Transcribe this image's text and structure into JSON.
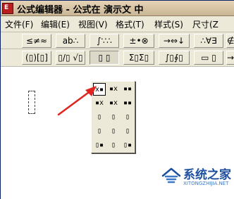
{
  "titlebar": {
    "title": "公式编辑器 - 公式在 演示文 中",
    "icon_letter": "Ε"
  },
  "menubar": {
    "items": [
      {
        "label": "文件(F)"
      },
      {
        "label": "编辑(E)"
      },
      {
        "label": "视图(V)"
      },
      {
        "label": "格式(T)"
      },
      {
        "label": "样式(S)"
      },
      {
        "label": "尺寸(Z"
      }
    ]
  },
  "toolbar_symbols": [
    {
      "label": "≤≠≈",
      "icon": "relations-icon"
    },
    {
      "label": "ab∴",
      "icon": "spaces-icon"
    },
    {
      "label": "∫∵∴",
      "icon": "embellishments-icon"
    },
    {
      "label": "±•⊗",
      "icon": "operators-icon"
    },
    {
      "label": "→⇔↓",
      "icon": "arrows-icon"
    },
    {
      "label": "∴∀∃",
      "icon": "logic-icon"
    },
    {
      "label": "∉",
      "icon": "set-theory-icon"
    }
  ],
  "toolbar_templates": [
    {
      "label": "(▯)[▯]",
      "icon": "fences-icon"
    },
    {
      "label": "▯/▯ √▯",
      "icon": "fractions-radicals-icon"
    },
    {
      "label": "▯ ▯",
      "icon": "subscript-superscript-icon"
    },
    {
      "label": "Σ▯Σ▯",
      "icon": "summations-icon"
    },
    {
      "label": "∫▯∮▯",
      "icon": "integrals-icon"
    },
    {
      "label": "▭ ▯",
      "icon": "underbar-overbar-icon"
    },
    {
      "label": "→",
      "icon": "labeled-arrows-icon"
    }
  ],
  "palette": {
    "rows": [
      [
        "x▪",
        "▪x",
        "▪▪"
      ],
      [
        "▪x",
        "▪x",
        "▪▪"
      ],
      [
        "▯",
        "▯",
        "▯"
      ],
      [
        "▯",
        "▯",
        "▯"
      ],
      [
        "▯▪",
        "▯",
        "▯▪"
      ]
    ],
    "selected": "superscript"
  },
  "watermark": {
    "brand": "系统之家",
    "url": "XITONGZHIJIA.NET"
  },
  "colors": {
    "arrow": "#e0241e",
    "watermark_blue": "#1e4f9e"
  }
}
